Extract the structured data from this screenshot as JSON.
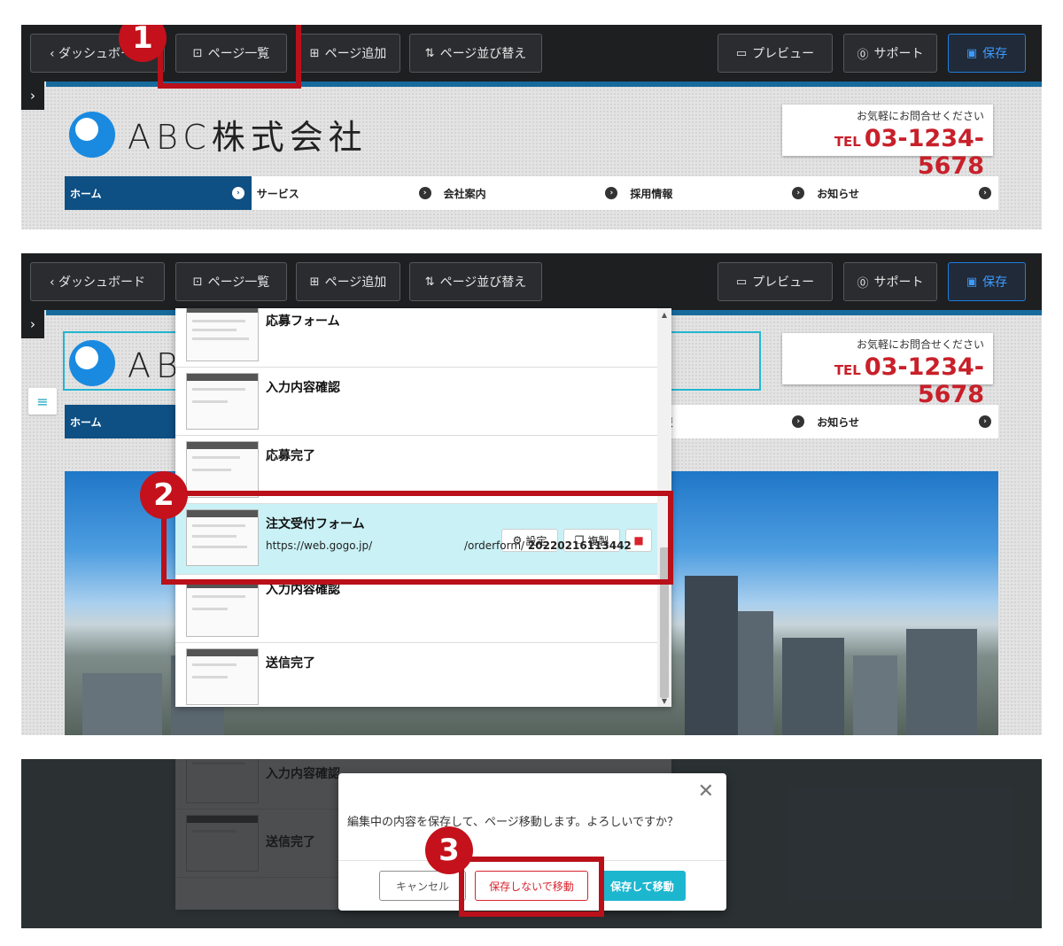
{
  "toolbar": {
    "dashboard_label": "‹ ダッシュボード",
    "page_list_label": "ページ一覧",
    "page_add_label": "ページ追加",
    "page_sort_label": "ページ並び替え",
    "preview_label": "プレビュー",
    "support_label": "サポート",
    "save_label": "保存"
  },
  "site": {
    "logo_text": "ABC株式会社",
    "tel_caption": "お気軽にお問合せください",
    "tel_label": "TEL",
    "tel_number": "03-1234-5678",
    "nav_items": [
      "ホーム",
      "サービス",
      "会社案内",
      "採用情報",
      "お知らせ"
    ]
  },
  "page_list": {
    "rows": [
      {
        "title": "応募フォーム"
      },
      {
        "title": "入力内容確認"
      },
      {
        "title": "応募完了"
      },
      {
        "title": "注文受付フォーム",
        "url": "https://web.gogo.jp/",
        "path": "/orderform/",
        "id": "20220216113442",
        "settings_label": "設定",
        "duplicate_label": "複製"
      },
      {
        "title": "入力内容確認"
      },
      {
        "title": "送信完了"
      }
    ]
  },
  "dialog": {
    "message": "編集中の内容を保存して、ページ移動します。よろしいですか？",
    "cancel_label": "キャンセル",
    "move_without_save_label": "保存しないで移動",
    "save_and_move_label": "保存して移動"
  },
  "steps": {
    "step1": "1",
    "step2": "2",
    "step3": "3"
  },
  "colors": {
    "highlight": "#b9101a",
    "accent": "#1cb6cf",
    "nav_active": "#0e4f84",
    "tel_red": "#c8202a"
  }
}
